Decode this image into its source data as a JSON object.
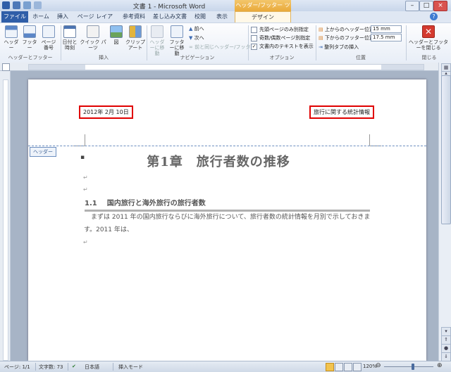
{
  "titlebar": {
    "title": "文書 1 - Microsoft Word",
    "context_tab_header": "ヘッダー/フッター ツール"
  },
  "tabs": [
    "ファイル",
    "ホーム",
    "挿入",
    "ページ レイアウト",
    "参考資料",
    "差し込み文書",
    "校閲",
    "表示",
    "デザイン"
  ],
  "ribbon": {
    "groups": {
      "header_footer": {
        "label": "ヘッダーとフッター",
        "buttons": [
          "ヘッダー",
          "フッター",
          "ページ番号"
        ]
      },
      "insert": {
        "label": "挿入",
        "buttons": [
          "日付と時刻",
          "クイック パーツ",
          "図",
          "クリップアート"
        ]
      },
      "navigation": {
        "label": "ナビゲーション",
        "buttons": [
          "ヘッダーに移動",
          "フッターに移動"
        ],
        "prev": "前へ",
        "next": "次へ",
        "link": "前と同じヘッダー/フッター"
      },
      "options": {
        "label": "オプション",
        "items": [
          {
            "label": "先頭ページのみ別指定",
            "checked": false
          },
          {
            "label": "奇数/偶数ページ別指定",
            "checked": false
          },
          {
            "label": "文書内のテキストを表示",
            "checked": true
          }
        ]
      },
      "position": {
        "label": "位置",
        "header_pos_label": "上からのヘッダー位置:",
        "header_pos_value": "15 mm",
        "footer_pos_label": "下からのフッター位置:",
        "footer_pos_value": "17.5 mm",
        "align_tab": "整列タブの挿入"
      },
      "close": {
        "label": "閉じる",
        "button": "ヘッダーとフッターを閉じる"
      }
    }
  },
  "document": {
    "header_date": "2012年 2月 10日",
    "header_right": "旅行に関する統計情報",
    "header_tag": "ヘッダー",
    "chapter_title": "第1章　旅行者数の推移",
    "section_number": "1.1",
    "section_title": "国内旅行と海外旅行の旅行者数",
    "body": "まずは 2011 年の国内旅行ならびに海外旅行について、旅行者数の統計情報を月別で示しておきます。2011 年は、",
    "para_mark": "↵"
  },
  "statusbar": {
    "page": "ページ: 1/1",
    "words": "文字数: 73",
    "language": "日本語",
    "mode": "挿入モード",
    "zoom": "120%"
  },
  "colors": {
    "file_tab": "#2f5ea8",
    "context_tab": "#e9a93a",
    "highlight_box": "#e00000"
  }
}
